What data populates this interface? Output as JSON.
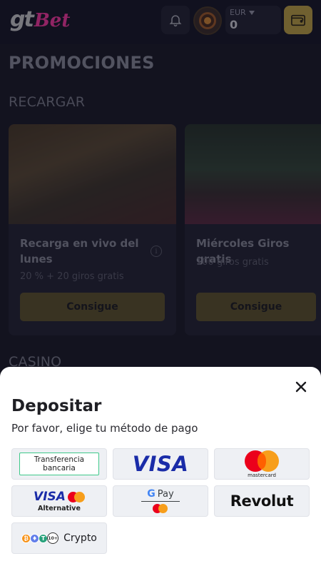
{
  "header": {
    "logo_main": "gt",
    "logo_accent": "Bet",
    "currency": "EUR",
    "balance": "0",
    "icons": [
      "bell-icon",
      "avatar",
      "chevron-down-icon",
      "wallet-icon"
    ]
  },
  "promotions": {
    "title": "PROMOCIONES",
    "section_recargar": "RECARGAR",
    "section_casino": "CASINO",
    "cards": [
      {
        "title": "Recarga en vivo del lunes",
        "subtitle": "20 % + 20 giros gratis",
        "cta": "Consigue"
      },
      {
        "title": "Miércoles Giros gratis",
        "subtitle": "100 giros gratis",
        "cta": "Consigue"
      }
    ]
  },
  "deposit": {
    "title": "Depositar",
    "subtitle": "Por favor, elige tu método de pago",
    "methods": {
      "transfer_line1": "Transferencia",
      "transfer_line2": "bancaria",
      "visa": "VISA",
      "mastercard": "mastercard",
      "visa_alt_brand": "VISA",
      "visa_alt_label": "Alternative",
      "gpay": "Pay",
      "gpay_g": "G",
      "revolut": "Revolut",
      "crypto": "Crypto",
      "crypto_more": "10+"
    }
  },
  "colors": {
    "accent_gold": "#c4a64a",
    "brand_pink": "#ff3aa8",
    "visa_blue": "#1a2ca8",
    "mc_red": "#eb001b",
    "mc_orange": "#f79e1b"
  }
}
